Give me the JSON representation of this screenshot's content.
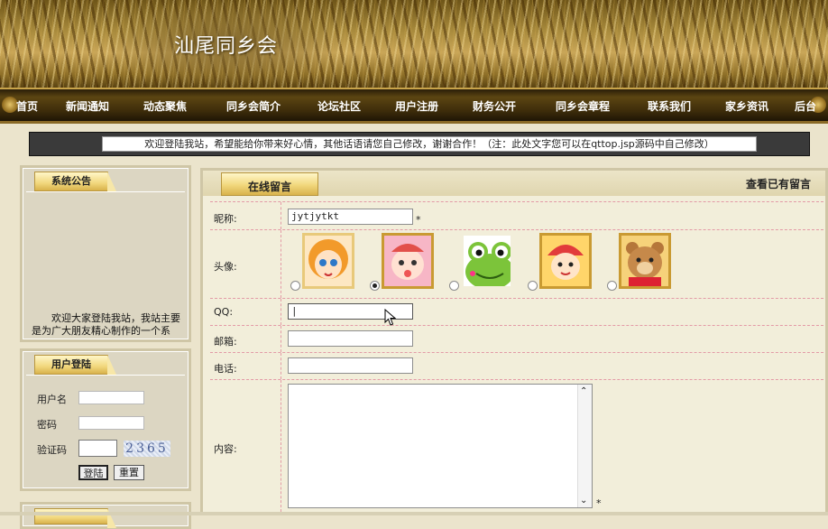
{
  "site": {
    "title": "汕尾同乡会"
  },
  "nav": [
    "首页",
    "新闻通知",
    "动态聚焦",
    "同乡会简介",
    "论坛社区",
    "用户注册",
    "财务公开",
    "同乡会章程",
    "联系我们",
    "家乡资讯",
    "后台"
  ],
  "marquee": "欢迎登陆我站，希望能给你带来好心情，其他话语请您自己修改，谢谢合作！（注：此处文字您可以在qttop.jsp源码中自己修改）",
  "notice_panel": {
    "title": "系统公告",
    "text": "欢迎大家登陆我站，我站主要是为广大朋友精心制作的一个系统，希望大家能够喜欢。"
  },
  "login_panel": {
    "title": "用户登陆",
    "username_label": "用户名",
    "password_label": "密码",
    "captcha_label": "验证码",
    "captcha_code": "2365",
    "login_button": "登陆",
    "reset_button": "重置"
  },
  "message_form": {
    "tab_title": "在线留言",
    "view_link": "查看已有留言",
    "nickname_label": "昵称:",
    "nickname_value": "jytjytkt",
    "avatar_label": "头像:",
    "qq_label": "QQ:",
    "email_label": "邮箱:",
    "phone_label": "电话:",
    "content_label": "内容:",
    "required_mark": "*",
    "selected_avatar_index": 1
  },
  "colors": {
    "accent_gold": "#f1d77c",
    "nav_bg": "#3c2b0a",
    "dashed_border": "#e39aa6",
    "page_bg": "#ebe4cc"
  }
}
